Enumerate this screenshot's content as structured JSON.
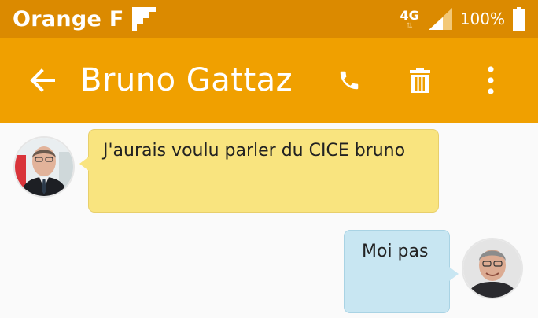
{
  "status_bar": {
    "carrier": "Orange F",
    "network": "4G",
    "battery": "100%"
  },
  "app_bar": {
    "contact_name": "Bruno Gattaz",
    "icons": [
      "back-arrow-icon",
      "phone-icon",
      "trash-icon",
      "more-vert-icon"
    ]
  },
  "colors": {
    "status_bar": "#db8a00",
    "app_bar": "#f0a000",
    "incoming_bubble": "#f9e47f",
    "outgoing_bubble": "#c8e6f2",
    "background": "#fafafa"
  },
  "messages": [
    {
      "direction": "incoming",
      "text": "J'aurais voulu parler du CICE bruno"
    },
    {
      "direction": "outgoing",
      "text": "Moi pas"
    }
  ]
}
